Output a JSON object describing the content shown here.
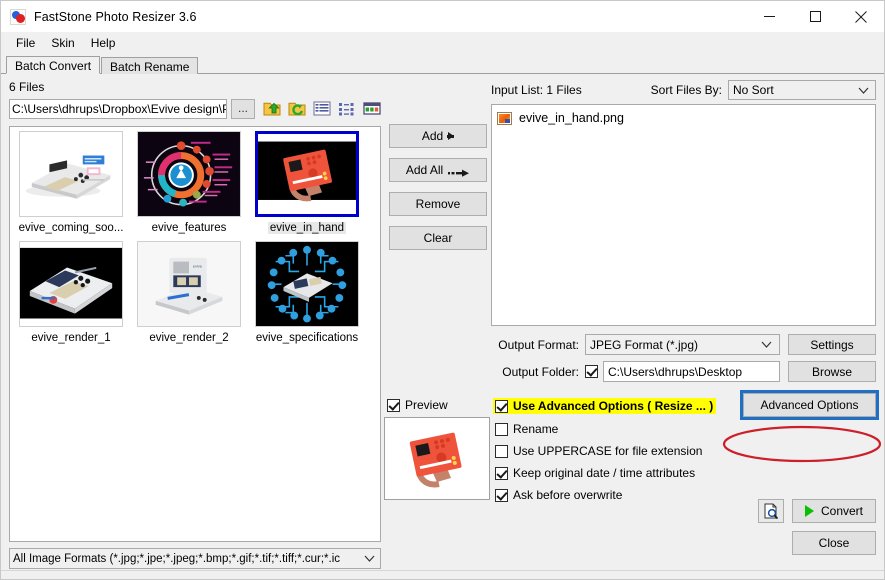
{
  "window": {
    "title": "FastStone Photo Resizer 3.6",
    "icon": "app-logo-icon",
    "controls": {
      "minimize": "minimize-icon",
      "maximize": "maximize-icon",
      "close": "close-icon"
    }
  },
  "menubar": {
    "items": [
      "File",
      "Skin",
      "Help"
    ]
  },
  "tabs": [
    {
      "label": "Batch Convert",
      "active": true
    },
    {
      "label": "Batch Rename",
      "active": false
    }
  ],
  "browser": {
    "files_count_label": "6 Files",
    "path_value": "C:\\Users\\dhrups\\Dropbox\\Evive design\\Pre",
    "browse_dots_label": "...",
    "toolbar_icons": [
      "up-folder-icon",
      "refresh-folder-icon",
      "list-view-icon",
      "details-view-icon",
      "thumbnail-view-icon"
    ],
    "thumbnails": [
      {
        "label": "evive_coming_soo...",
        "selected": false,
        "kind": "device-white-photo"
      },
      {
        "label": "evive_features",
        "selected": false,
        "kind": "features-wheel-dark"
      },
      {
        "label": "evive_in_hand",
        "selected": true,
        "kind": "orange-device-in-hand"
      },
      {
        "label": "evive_render_1",
        "selected": false,
        "kind": "render-dark-1"
      },
      {
        "label": "evive_render_2",
        "selected": false,
        "kind": "render-light-2"
      },
      {
        "label": "evive_specifications",
        "selected": false,
        "kind": "specs-circuit-dark"
      }
    ],
    "format_filter": "All Image Formats (*.jpg;*.jpe;*.jpeg;*.bmp;*.gif;*.tif;*.tiff;*.cur;*.ic"
  },
  "transfer_buttons": [
    {
      "label": "Add",
      "icon": "arrow-right-icon"
    },
    {
      "label": "Add All",
      "icon": "arrow-right-double-icon"
    },
    {
      "label": "Remove",
      "icon": ""
    },
    {
      "label": "Clear",
      "icon": ""
    }
  ],
  "input_list": {
    "header_label": "Input List:  1 Files",
    "sort_label": "Sort Files By:",
    "sort_value": "No Sort",
    "files": [
      {
        "name": "evive_in_hand.png",
        "icon": "image-file-icon"
      }
    ]
  },
  "output": {
    "format_label": "Output Format:",
    "format_value": "JPEG Format (*.jpg)",
    "settings_label": "Settings",
    "folder_label": "Output Folder:",
    "folder_checked": true,
    "folder_value": "C:\\Users\\dhrups\\Desktop",
    "browse_label": "Browse"
  },
  "options": {
    "preview": {
      "label": "Preview",
      "checked": true
    },
    "items": [
      {
        "label": "Use Advanced Options ( Resize ... )",
        "checked": true,
        "highlighted": true
      },
      {
        "label": "Rename",
        "checked": false,
        "highlighted": false
      },
      {
        "label": "Use UPPERCASE for file extension",
        "checked": false,
        "highlighted": false
      },
      {
        "label": "Keep original date / time attributes",
        "checked": true,
        "highlighted": false
      },
      {
        "label": "Ask before overwrite",
        "checked": true,
        "highlighted": false
      }
    ],
    "advanced_button": "Advanced Options"
  },
  "actions": {
    "magnifier_icon": "preview-magnifier-icon",
    "convert_label": "Convert",
    "convert_icon": "play-triangle-icon",
    "close_label": "Close"
  },
  "annotations": {
    "highlight_color": "#ffff00",
    "focus_box_color": "#1f6fc4",
    "ellipse_color": "#cc1f2a"
  }
}
